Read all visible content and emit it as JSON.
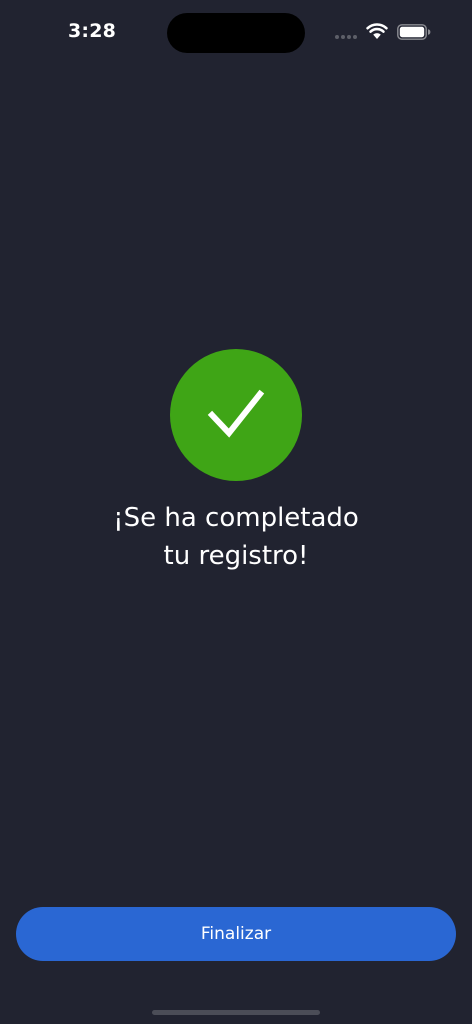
{
  "status_bar": {
    "time": "3:28",
    "icons": [
      "signal-dots-icon",
      "wifi-icon",
      "battery-icon"
    ]
  },
  "success": {
    "icon": "checkmark-icon",
    "color": "#3fa516",
    "title_line1": "¡Se ha completado",
    "title_line2": "tu registro!"
  },
  "footer": {
    "finish_label": "Finalizar",
    "button_color": "#2a67d3"
  },
  "theme": {
    "background": "#212330"
  }
}
